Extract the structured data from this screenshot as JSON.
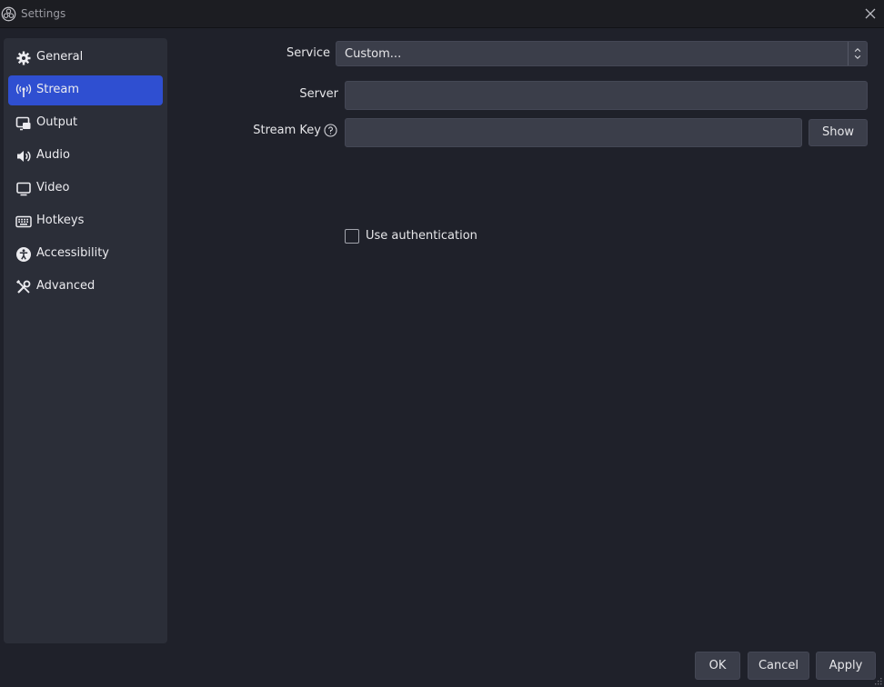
{
  "window": {
    "title": "Settings"
  },
  "sidebar": {
    "items": [
      {
        "label": "General",
        "icon": "gear-icon"
      },
      {
        "label": "Stream",
        "icon": "antenna-icon",
        "active": true
      },
      {
        "label": "Output",
        "icon": "output-icon"
      },
      {
        "label": "Audio",
        "icon": "speaker-icon"
      },
      {
        "label": "Video",
        "icon": "monitor-icon"
      },
      {
        "label": "Hotkeys",
        "icon": "keyboard-icon"
      },
      {
        "label": "Accessibility",
        "icon": "accessibility-icon"
      },
      {
        "label": "Advanced",
        "icon": "tools-icon"
      }
    ]
  },
  "stream": {
    "service_label": "Service",
    "service_value": "Custom...",
    "server_label": "Server",
    "server_value": "",
    "key_label": "Stream Key",
    "key_value": "",
    "show_label": "Show",
    "use_auth_label": "Use authentication",
    "use_auth_checked": false
  },
  "footer": {
    "ok_label": "OK",
    "cancel_label": "Cancel",
    "apply_label": "Apply"
  },
  "colors": {
    "accent": "#2f4fd1",
    "background": "#1f212a",
    "sidebar": "#2b2e38",
    "field": "#3b3e4a"
  }
}
